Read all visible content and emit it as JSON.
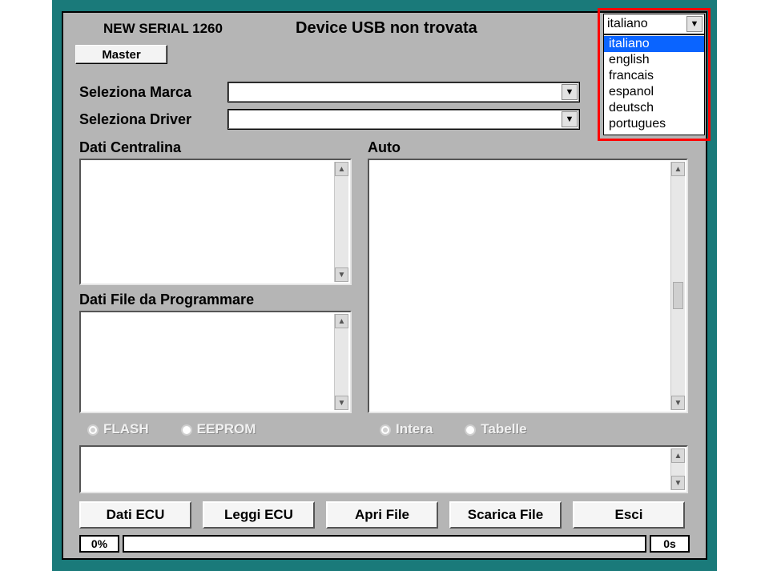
{
  "header": {
    "serial": "NEW SERIAL 1260",
    "status": "Device USB non trovata",
    "master_label": "Master"
  },
  "language": {
    "selected": "italiano",
    "options": [
      "italiano",
      "english",
      "francais",
      "espanol",
      "deutsch",
      "portugues"
    ]
  },
  "form": {
    "marca_label": "Seleziona Marca",
    "driver_label": "Seleziona Driver",
    "marca_value": "",
    "driver_value": ""
  },
  "sections": {
    "centralina": "Dati Centralina",
    "fileprog": "Dati File da Programmare",
    "auto": "Auto"
  },
  "radios": {
    "flash": "FLASH",
    "eeprom": "EEPROM",
    "intera": "Intera",
    "tabelle": "Tabelle"
  },
  "buttons": {
    "dati_ecu": "Dati ECU",
    "leggi_ecu": "Leggi ECU",
    "apri_file": "Apri File",
    "scarica_file": "Scarica File",
    "esci": "Esci"
  },
  "progress": {
    "percent": "0%",
    "elapsed": "0s"
  }
}
